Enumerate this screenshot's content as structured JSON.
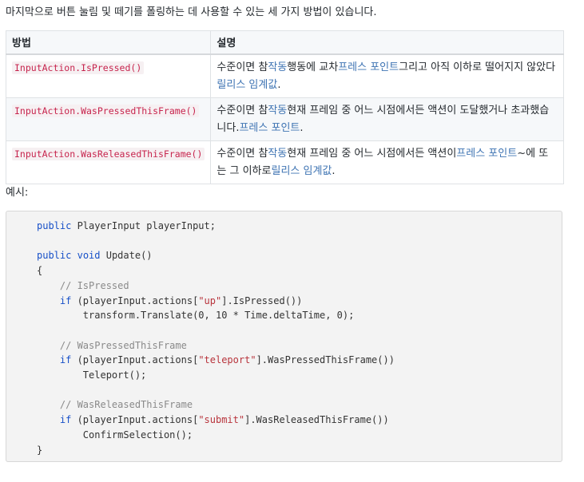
{
  "intro": "마지막으로 버튼 눌림 및 떼기를 폴링하는 데 사용할 수 있는 세 가지 방법이 있습니다.",
  "table": {
    "headers": [
      "방법",
      "설명"
    ],
    "rows": [
      {
        "method": "InputAction.IsPressed()",
        "desc": [
          {
            "text": "수준이면 참",
            "link": false
          },
          {
            "text": "작동",
            "link": true
          },
          {
            "text": "행동에 교차",
            "link": false
          },
          {
            "text": "프레스 포인트",
            "link": true
          },
          {
            "text": "그리고 아직 이하로 떨어지지 않았다",
            "link": false
          },
          {
            "text": "릴리스 임계값",
            "link": true
          },
          {
            "text": ".",
            "link": false
          }
        ]
      },
      {
        "method": "InputAction.WasPressedThisFrame()",
        "desc": [
          {
            "text": "수준이면 참",
            "link": false
          },
          {
            "text": "작동",
            "link": true
          },
          {
            "text": "현재 프레임 중 어느 시점에서든 액션이 도달했거나 초과했습니다.",
            "link": false
          },
          {
            "text": "프레스 포인트",
            "link": true
          },
          {
            "text": ".",
            "link": false
          }
        ]
      },
      {
        "method": "InputAction.WasReleasedThisFrame()",
        "desc": [
          {
            "text": "수준이면 참",
            "link": false
          },
          {
            "text": "작동",
            "link": true
          },
          {
            "text": "현재 프레임 중 어느 시점에서든 액션이",
            "link": false
          },
          {
            "text": "프레스 포인트",
            "link": true
          },
          {
            "text": "~에 또는 그 이하로",
            "link": false
          },
          {
            "text": "릴리스 임계값",
            "link": true
          },
          {
            "text": ".",
            "link": false
          }
        ]
      }
    ]
  },
  "example_label": "예시:",
  "code": [
    [
      {
        "t": "public",
        "c": "kw"
      },
      {
        "t": " PlayerInput playerInput;",
        "c": ""
      }
    ],
    [],
    [
      {
        "t": "public",
        "c": "kw"
      },
      {
        "t": " ",
        "c": ""
      },
      {
        "t": "void",
        "c": "kw"
      },
      {
        "t": " Update()",
        "c": ""
      }
    ],
    [
      {
        "t": "{",
        "c": ""
      }
    ],
    [
      {
        "t": "    ",
        "c": ""
      },
      {
        "t": "// IsPressed",
        "c": "cm"
      }
    ],
    [
      {
        "t": "    ",
        "c": ""
      },
      {
        "t": "if",
        "c": "kw"
      },
      {
        "t": " (playerInput.actions[",
        "c": ""
      },
      {
        "t": "\"up\"",
        "c": "st"
      },
      {
        "t": "].IsPressed())",
        "c": ""
      }
    ],
    [
      {
        "t": "        transform.Translate(0, 10 * Time.deltaTime, 0);",
        "c": ""
      }
    ],
    [],
    [
      {
        "t": "    ",
        "c": ""
      },
      {
        "t": "// WasPressedThisFrame",
        "c": "cm"
      }
    ],
    [
      {
        "t": "    ",
        "c": ""
      },
      {
        "t": "if",
        "c": "kw"
      },
      {
        "t": " (playerInput.actions[",
        "c": ""
      },
      {
        "t": "\"teleport\"",
        "c": "st"
      },
      {
        "t": "].WasPressedThisFrame())",
        "c": ""
      }
    ],
    [
      {
        "t": "        Teleport();",
        "c": ""
      }
    ],
    [],
    [
      {
        "t": "    ",
        "c": ""
      },
      {
        "t": "// WasReleasedThisFrame",
        "c": "cm"
      }
    ],
    [
      {
        "t": "    ",
        "c": ""
      },
      {
        "t": "if",
        "c": "kw"
      },
      {
        "t": " (playerInput.actions[",
        "c": ""
      },
      {
        "t": "\"submit\"",
        "c": "st"
      },
      {
        "t": "].WasReleasedThisFrame())",
        "c": ""
      }
    ],
    [
      {
        "t": "        ConfirmSelection();",
        "c": ""
      }
    ],
    [
      {
        "t": "}",
        "c": ""
      }
    ]
  ]
}
